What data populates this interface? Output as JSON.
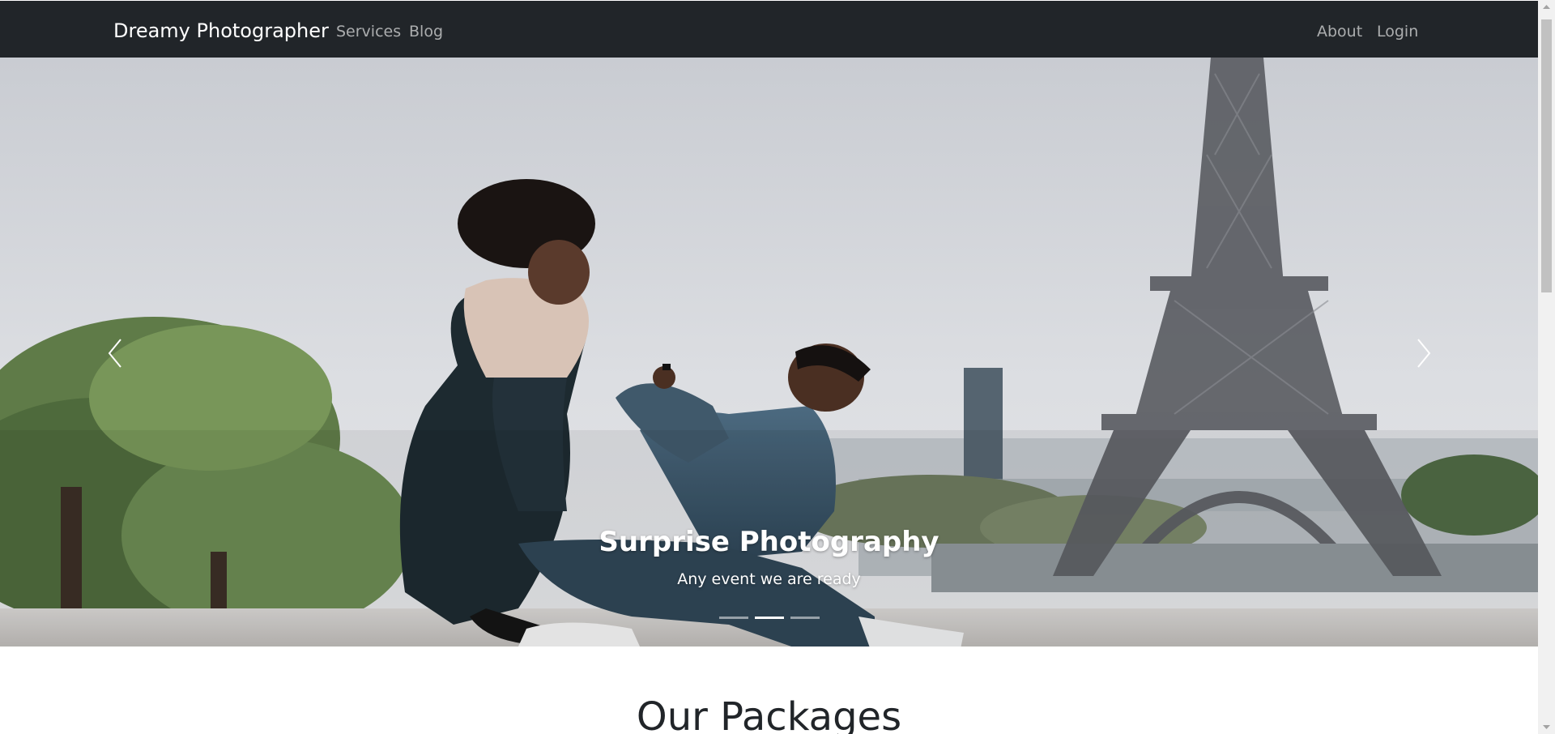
{
  "navbar": {
    "brand": "Dreamy Photographer",
    "left_links": [
      "Services",
      "Blog"
    ],
    "right_links": [
      "About",
      "Login"
    ]
  },
  "carousel": {
    "caption_title": "Surprise Photography",
    "caption_text": "Any event we are ready",
    "slide_count": 3,
    "active_slide": 2,
    "prev_icon": "chevron-left-icon",
    "next_icon": "chevron-right-icon"
  },
  "packages": {
    "heading": "Our Packages"
  },
  "colors": {
    "navbar_bg": "#212529",
    "brand_text": "#ffffff",
    "nav_link_text": "rgba(255,255,255,0.62)",
    "heading_text": "#212529"
  }
}
